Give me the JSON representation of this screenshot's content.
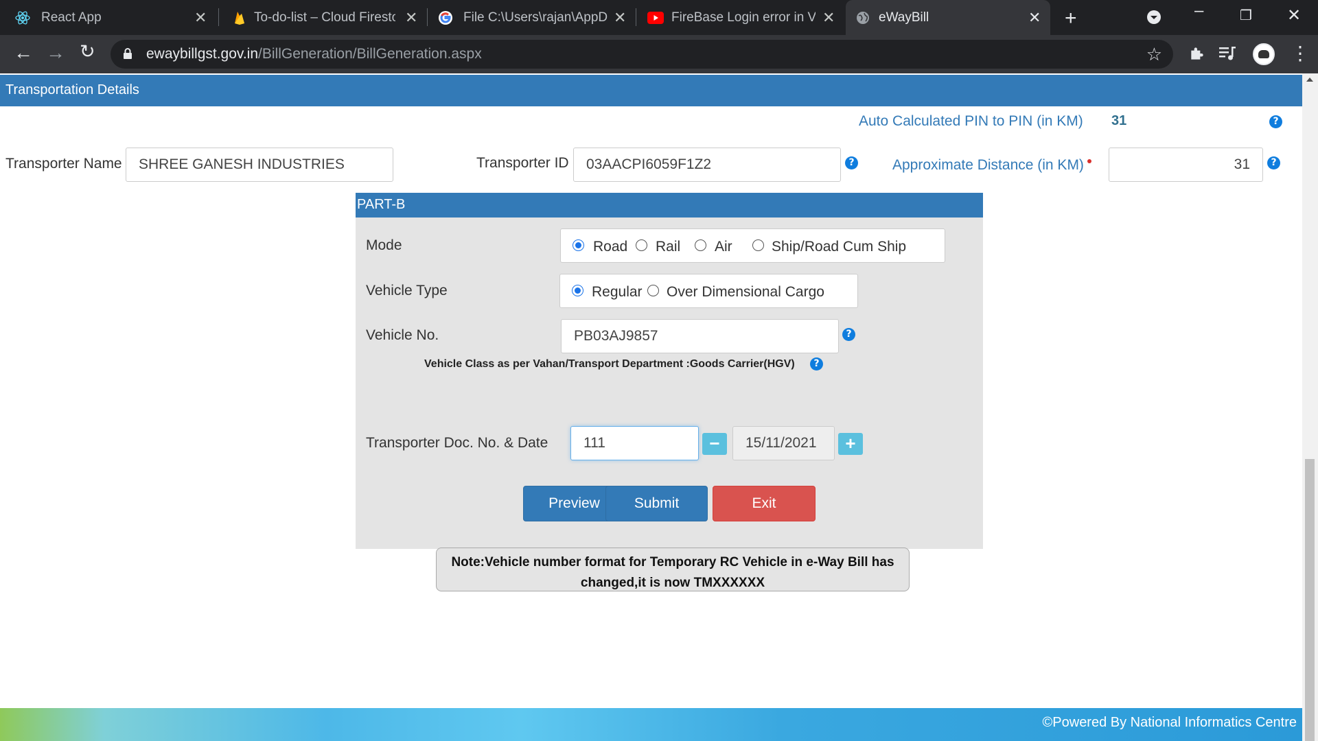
{
  "browser": {
    "tabs": [
      {
        "title": "React App",
        "icon": "react-icon"
      },
      {
        "title": "To-do-list – Cloud Firestore",
        "icon": "firebase-icon"
      },
      {
        "title": "File C:\\Users\\rajan\\AppData",
        "icon": "google-icon"
      },
      {
        "title": "FireBase Login error in VsCode",
        "icon": "youtube-icon"
      },
      {
        "title": "eWayBill",
        "icon": "globe-icon"
      }
    ],
    "url_host": "ewaybillgst.gov.in",
    "url_path": "/BillGeneration/BillGeneration.aspx"
  },
  "section": {
    "title": "Transportation Details"
  },
  "auto_distance": {
    "label": "Auto Calculated PIN to PIN (in KM)",
    "value": "31"
  },
  "transporter": {
    "name_label": "Transporter Name",
    "name_value": "SHREE GANESH INDUSTRIES",
    "id_label": "Transporter ID",
    "id_value": "03AACPI6059F1Z2",
    "distance_label": "Approximate Distance (in KM)",
    "distance_value": "31"
  },
  "partb": {
    "title": "PART-B",
    "mode_label": "Mode",
    "modes": [
      "Road",
      "Rail",
      "Air",
      "Ship/Road Cum Ship"
    ],
    "mode_selected": "Road",
    "vehicle_type_label": "Vehicle Type",
    "vehicle_types": [
      "Regular",
      "Over Dimensional Cargo"
    ],
    "vehicle_type_selected": "Regular",
    "vehicle_no_label": "Vehicle No.",
    "vehicle_no_value": "PB03AJ9857",
    "vehicle_class": "Vehicle Class as per Vahan/Transport Department :Goods Carrier(HGV)",
    "doc_label": "Transporter Doc. No. & Date",
    "doc_no": "111",
    "doc_date": "15/11/2021"
  },
  "buttons": {
    "preview": "Preview",
    "submit": "Submit",
    "exit": "Exit"
  },
  "note": {
    "line1": "Note:Vehicle number format for Temporary RC Vehicle in e-Way Bill has",
    "line2": "changed,it is now TMXXXXXX"
  },
  "footer": {
    "text": "Powered By National Informatics Centre",
    "copyright_symbol": "©"
  },
  "colors": {
    "header_blue": "#337ab7",
    "exit_red": "#d9534f",
    "stepper_cyan": "#5bc0de",
    "help_blue": "#0f7dde"
  }
}
